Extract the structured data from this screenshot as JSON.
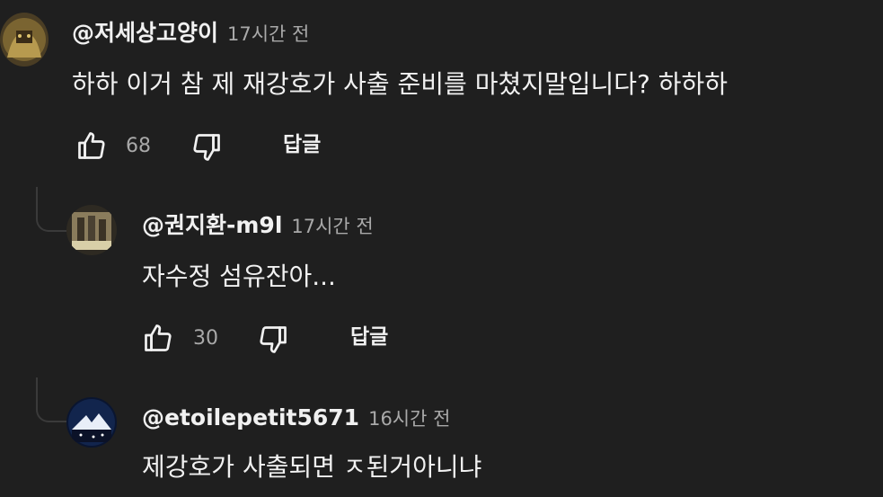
{
  "comments": [
    {
      "handle": "@저세상고양이",
      "time": "17시간 전",
      "text": "하하 이거 참 제 재강호가 사출 준비를 마쳤지말입니다? 하하하",
      "likes": "68",
      "reply_label": "답글"
    },
    {
      "handle": "@권지환-m9l",
      "time": "17시간 전",
      "text": "자수정 섬유잔아...",
      "likes": "30",
      "reply_label": "답글"
    },
    {
      "handle": "@etoilepetit5671",
      "time": "16시간 전",
      "text": "제강호가 사출되면 ㅈ된거아니냐"
    }
  ],
  "colors": {
    "background": "#1f1f1f",
    "text": "#f1f1f1",
    "meta": "#a9a9a9"
  },
  "icons": {
    "like": "thumbs-up-icon",
    "dislike": "thumbs-down-icon"
  }
}
